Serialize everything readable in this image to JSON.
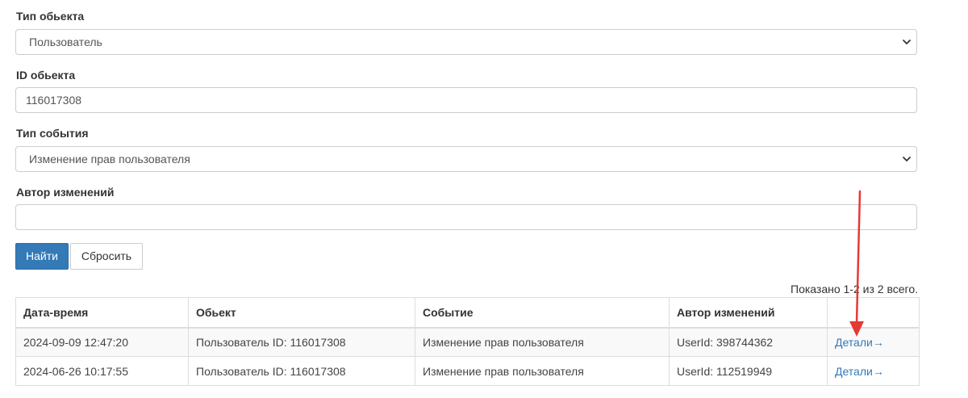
{
  "filters": {
    "object_type": {
      "label": "Тип обьекта",
      "value": "Пользователь"
    },
    "object_id": {
      "label": "ID обьекта",
      "value": "116017308"
    },
    "event_type": {
      "label": "Тип события",
      "value": "Изменение прав пользователя"
    },
    "author": {
      "label": "Автор изменений",
      "value": ""
    }
  },
  "buttons": {
    "find": "Найти",
    "reset": "Сбросить"
  },
  "summary": "Показано 1-2 из 2 всего.",
  "table": {
    "columns": [
      "Дата-время",
      "Обьект",
      "Событие",
      "Автор изменений",
      ""
    ],
    "rows": [
      {
        "datetime": "2024-09-09 12:47:20",
        "object": "Пользователь ID: 116017308",
        "event": "Изменение прав пользователя",
        "author": "UserId: 398744362",
        "link": "Детали→"
      },
      {
        "datetime": "2024-06-26 10:17:55",
        "object": "Пользователь ID: 116017308",
        "event": "Изменение прав пользователя",
        "author": "UserId: 112519949",
        "link": "Детали→"
      }
    ]
  },
  "annotation_color": "#e53935",
  "primary_color": "#337ab7"
}
